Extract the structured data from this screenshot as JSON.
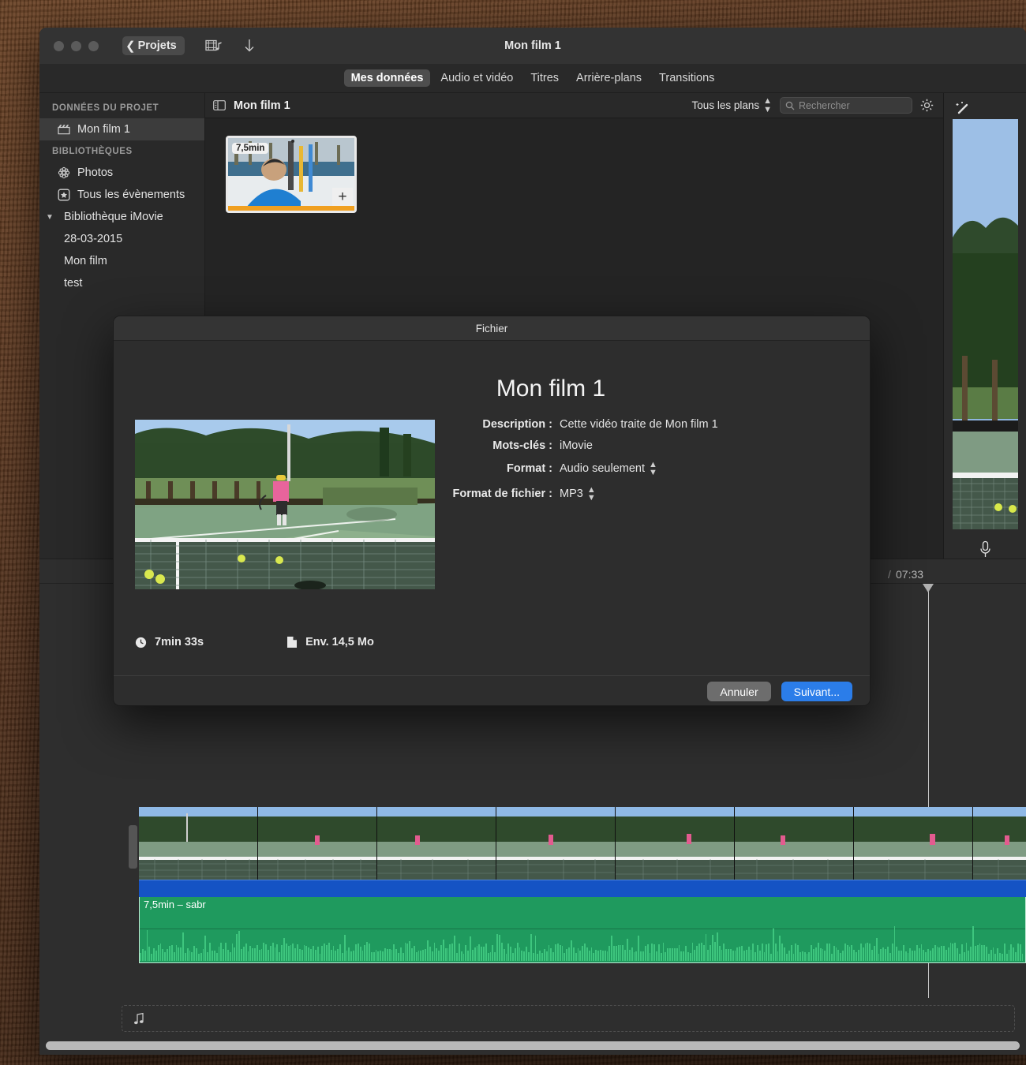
{
  "window": {
    "title": "Mon film 1",
    "back_label": "Projets",
    "icons": {
      "filmstrip_music": "filmstrip-music-icon",
      "download": "download-arrow-icon"
    }
  },
  "tabs": [
    {
      "label": "Mes données",
      "active": true
    },
    {
      "label": "Audio et vidéo",
      "active": false
    },
    {
      "label": "Titres",
      "active": false
    },
    {
      "label": "Arrière-plans",
      "active": false
    },
    {
      "label": "Transitions",
      "active": false
    }
  ],
  "sidebar": {
    "section_project": "DONNÉES DU PROJET",
    "section_libraries": "BIBLIOTHÈQUES",
    "project_items": [
      {
        "label": "Mon film 1",
        "icon": "clapperboard-icon",
        "selected": true
      }
    ],
    "library_items": [
      {
        "label": "Photos",
        "icon": "photos-icon"
      },
      {
        "label": "Tous les évènements",
        "icon": "star-badge-icon"
      }
    ],
    "library_group": {
      "label": "Bibliothèque iMovie",
      "expanded": true
    },
    "library_children": [
      {
        "label": "28-03-2015"
      },
      {
        "label": "Mon film"
      },
      {
        "label": "test"
      }
    ]
  },
  "browser": {
    "title": "Mon film 1",
    "filter_label": "Tous les plans",
    "search_placeholder": "Rechercher",
    "search_value": "",
    "clip": {
      "duration_badge": "7,5min",
      "add_label": "+"
    }
  },
  "timeline": {
    "time_separator": "/",
    "total_duration": "07:33",
    "audio_clip_label": "7,5min – sabr",
    "music_drop_icon": "music-note-icon"
  },
  "dialog": {
    "header": "Fichier",
    "title": "Mon film 1",
    "fields": [
      {
        "label": "Description :",
        "value": "Cette vidéo traite de Mon film 1",
        "has_stepper": false
      },
      {
        "label": "Mots-clés :",
        "value": "iMovie",
        "has_stepper": false
      },
      {
        "label": "Format :",
        "value": "Audio seulement",
        "has_stepper": true
      },
      {
        "label": "Format de fichier :",
        "value": "MP3",
        "has_stepper": true
      }
    ],
    "duration": "7min 33s",
    "size": "Env. 14,5 Mo",
    "buttons": {
      "cancel": "Annuler",
      "primary": "Suivant..."
    }
  },
  "colors": {
    "accent_blue": "#2b7de9",
    "audio_green": "#1f9a5e",
    "video_bar_blue": "#1553c4",
    "selection_orange": "#f0a021",
    "window_bg": "#2b2b2b"
  }
}
